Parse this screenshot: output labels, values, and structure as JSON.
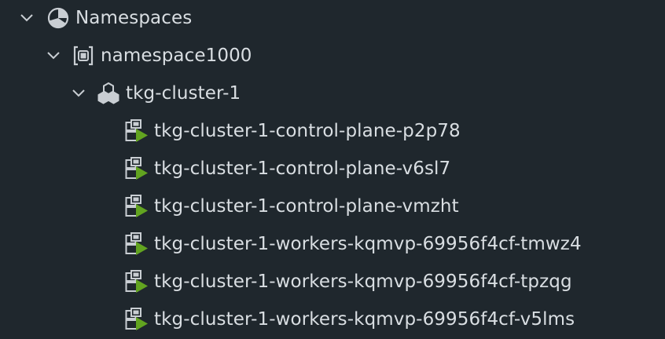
{
  "tree": {
    "root": {
      "label": "Namespaces",
      "expanded": true,
      "icon": "namespaces-pie-icon"
    },
    "namespace": {
      "label": "namespace1000",
      "expanded": true,
      "icon": "namespace-icon"
    },
    "cluster": {
      "label": "tkg-cluster-1",
      "expanded": true,
      "icon": "cluster-icon"
    },
    "vms": [
      {
        "label": "tkg-cluster-1-control-plane-p2p78",
        "icon": "vm-powered-on-icon"
      },
      {
        "label": "tkg-cluster-1-control-plane-v6sl7",
        "icon": "vm-powered-on-icon"
      },
      {
        "label": "tkg-cluster-1-control-plane-vmzht",
        "icon": "vm-powered-on-icon"
      },
      {
        "label": "tkg-cluster-1-workers-kqmvp-69956f4cf-tmwz4",
        "icon": "vm-powered-on-icon"
      },
      {
        "label": "tkg-cluster-1-workers-kqmvp-69956f4cf-tpzqg",
        "icon": "vm-powered-on-icon"
      },
      {
        "label": "tkg-cluster-1-workers-kqmvp-69956f4cf-v5lms",
        "icon": "vm-powered-on-icon"
      }
    ],
    "colors": {
      "background": "#1f272d",
      "text": "#d9dee2",
      "icon": "#c9ced3",
      "power_on": "#62a420"
    }
  }
}
